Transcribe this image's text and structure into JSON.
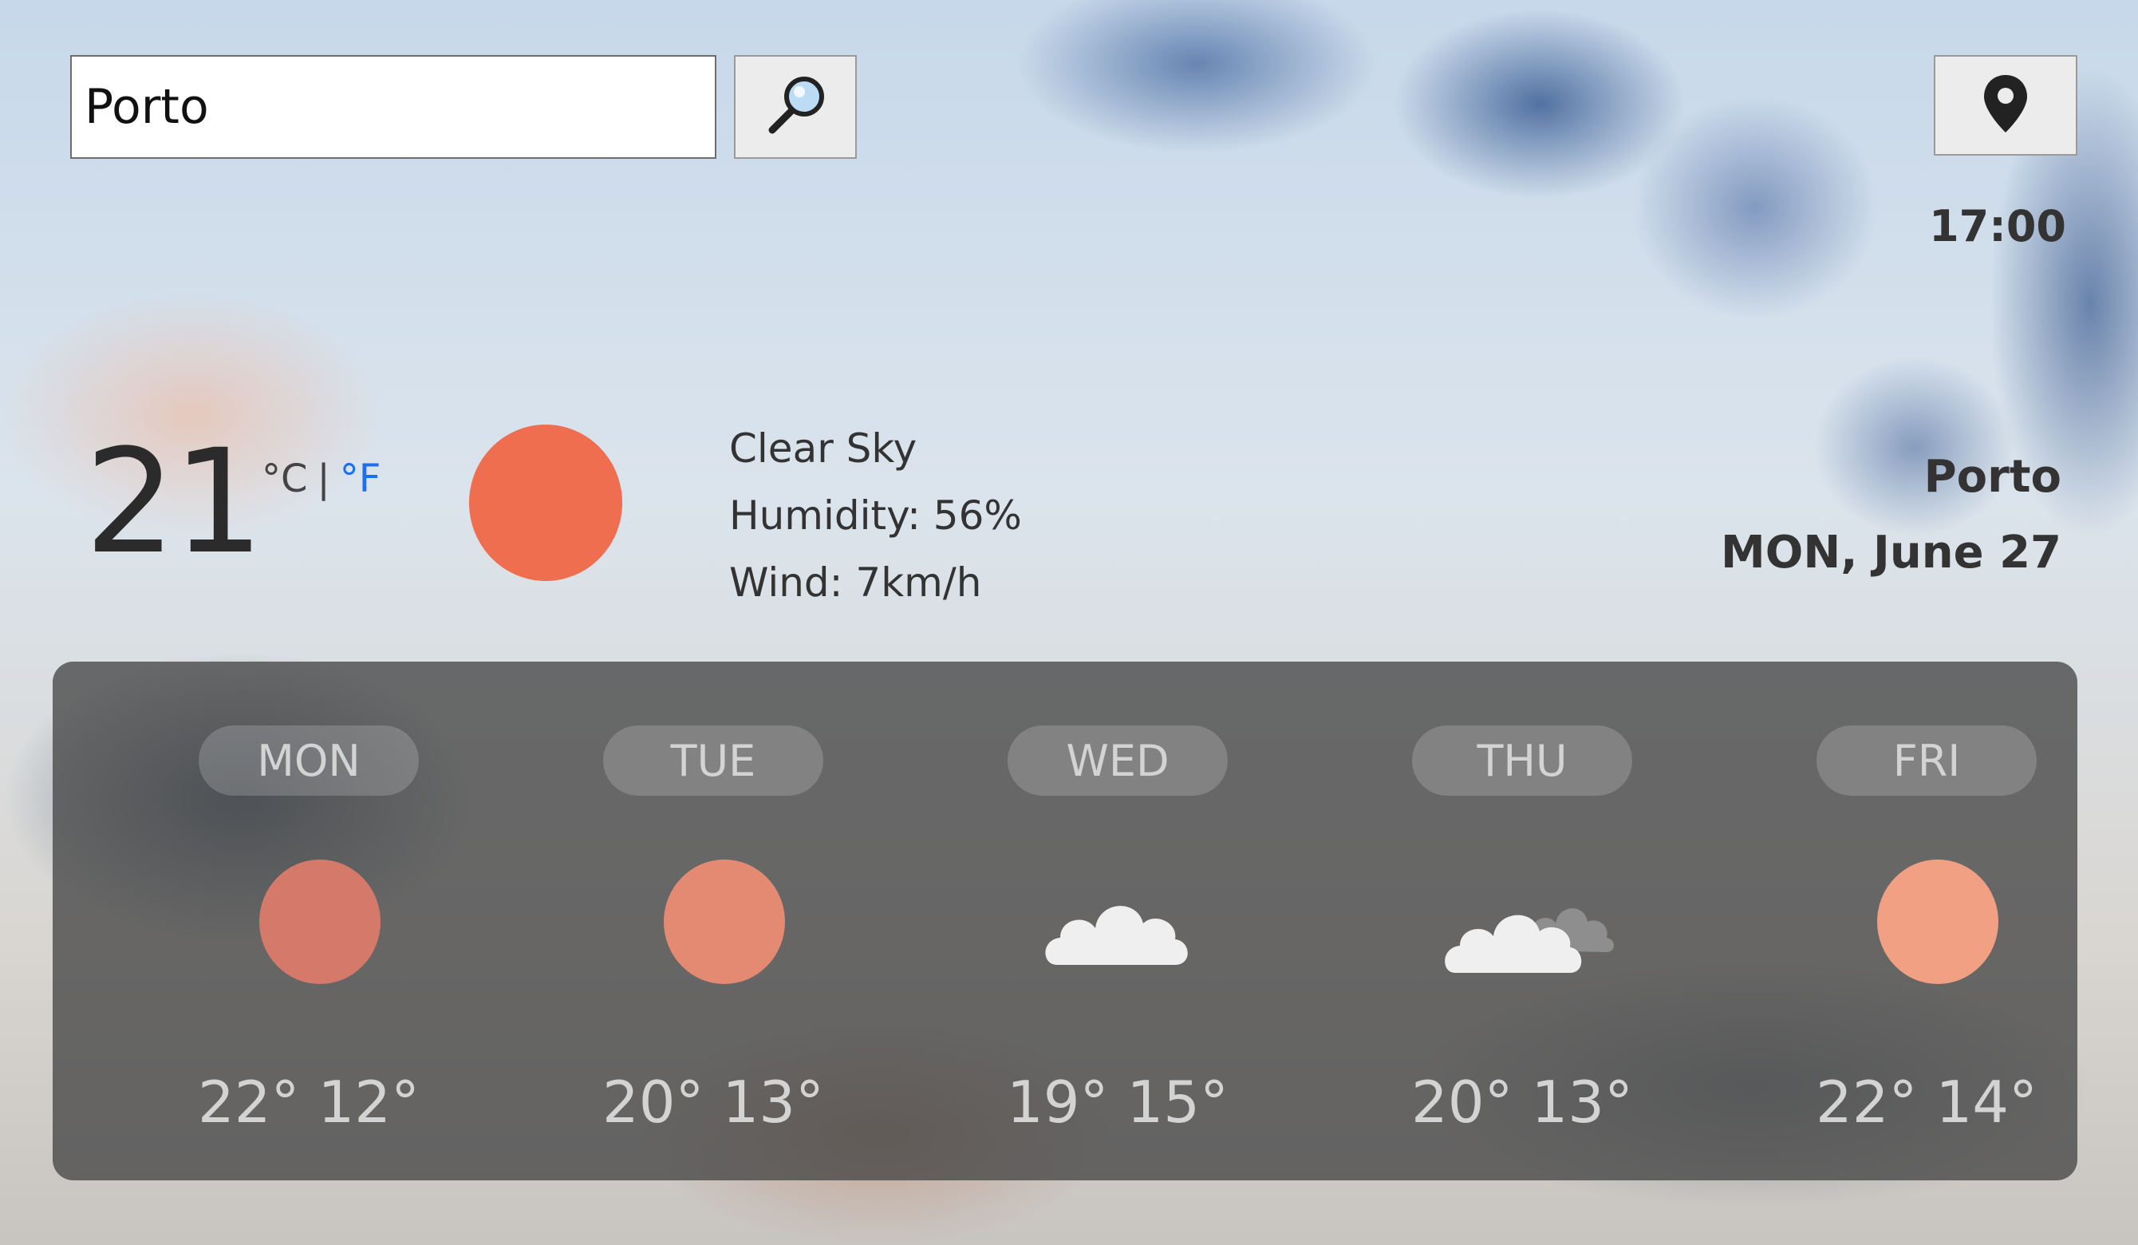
{
  "search": {
    "value": "Porto"
  },
  "header": {
    "time": "17:00"
  },
  "current": {
    "temperature": "21",
    "unit_c": "°C",
    "unit_sep": "|",
    "unit_f": "°F",
    "condition": "Clear Sky",
    "humidity": "Humidity: 56%",
    "wind": "Wind: 7km/h",
    "icon": "sun-icon"
  },
  "location": {
    "city": "Porto",
    "date": "MON, June 27"
  },
  "colors": {
    "sun_current": "#ee6e4f",
    "sun_mon": "#d57a6a",
    "sun_tue": "#e58a72",
    "sun_fri": "#f2a083",
    "unit_active_link": "#1d6ff2"
  },
  "forecast": [
    {
      "day": "MON",
      "temps": "22° 12°",
      "icon": "sun-icon"
    },
    {
      "day": "TUE",
      "temps": "20° 13°",
      "icon": "sun-icon"
    },
    {
      "day": "WED",
      "temps": "19° 15°",
      "icon": "cloud-icon"
    },
    {
      "day": "THU",
      "temps": "20° 13°",
      "icon": "clouds-icon"
    },
    {
      "day": "FRI",
      "temps": "22° 14°",
      "icon": "sun-icon"
    }
  ]
}
